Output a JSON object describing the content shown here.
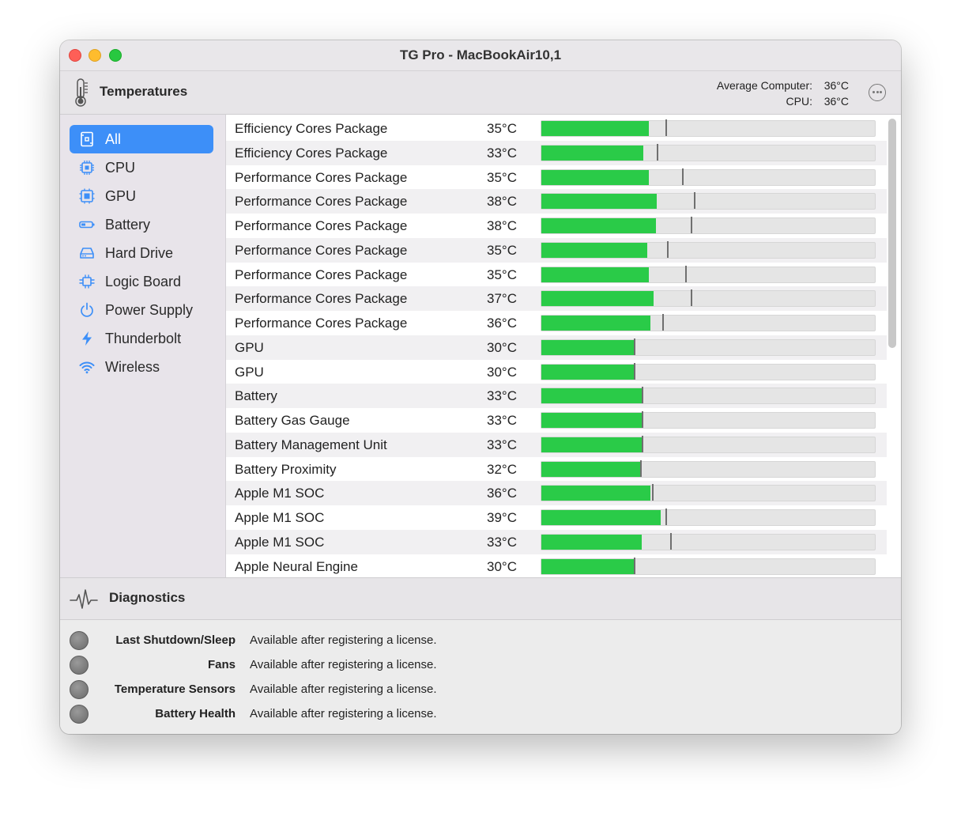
{
  "window": {
    "title": "TG Pro - MacBookAir10,1"
  },
  "temperatures": {
    "title": "Temperatures",
    "average_label": "Average Computer:",
    "average_value": "36°C",
    "cpu_label": "CPU:",
    "cpu_value": "36°C"
  },
  "sidebar": {
    "items": [
      {
        "label": "All",
        "icon": "board-icon",
        "active": true
      },
      {
        "label": "CPU",
        "icon": "chip-icon",
        "active": false
      },
      {
        "label": "GPU",
        "icon": "gpu-icon",
        "active": false
      },
      {
        "label": "Battery",
        "icon": "battery-icon",
        "active": false
      },
      {
        "label": "Hard Drive",
        "icon": "drive-icon",
        "active": false
      },
      {
        "label": "Logic Board",
        "icon": "logic-board-icon",
        "active": false
      },
      {
        "label": "Power Supply",
        "icon": "power-icon",
        "active": false
      },
      {
        "label": "Thunderbolt",
        "icon": "bolt-icon",
        "active": false
      },
      {
        "label": "Wireless",
        "icon": "wifi-icon",
        "active": false
      }
    ]
  },
  "sensors": [
    {
      "name": "Efficiency Cores Package",
      "temp": "35°C",
      "fill": 0.32,
      "max": 0.37
    },
    {
      "name": "Efficiency Cores Package",
      "temp": "33°C",
      "fill": 0.305,
      "max": 0.345
    },
    {
      "name": "Performance Cores Package",
      "temp": "35°C",
      "fill": 0.32,
      "max": 0.42
    },
    {
      "name": "Performance Cores Package",
      "temp": "38°C",
      "fill": 0.345,
      "max": 0.455
    },
    {
      "name": "Performance Cores Package",
      "temp": "38°C",
      "fill": 0.343,
      "max": 0.445
    },
    {
      "name": "Performance Cores Package",
      "temp": "35°C",
      "fill": 0.317,
      "max": 0.375
    },
    {
      "name": "Performance Cores Package",
      "temp": "35°C",
      "fill": 0.32,
      "max": 0.43
    },
    {
      "name": "Performance Cores Package",
      "temp": "37°C",
      "fill": 0.335,
      "max": 0.445
    },
    {
      "name": "Performance Cores Package",
      "temp": "36°C",
      "fill": 0.325,
      "max": 0.36
    },
    {
      "name": "GPU",
      "temp": "30°C",
      "fill": 0.275,
      "max": 0.275
    },
    {
      "name": "GPU",
      "temp": "30°C",
      "fill": 0.275,
      "max": 0.275
    },
    {
      "name": "Battery",
      "temp": "33°C",
      "fill": 0.3,
      "max": 0.3
    },
    {
      "name": "Battery Gas Gauge",
      "temp": "33°C",
      "fill": 0.3,
      "max": 0.3
    },
    {
      "name": "Battery Management Unit",
      "temp": "33°C",
      "fill": 0.3,
      "max": 0.3
    },
    {
      "name": "Battery Proximity",
      "temp": "32°C",
      "fill": 0.295,
      "max": 0.295
    },
    {
      "name": "Apple M1 SOC",
      "temp": "36°C",
      "fill": 0.325,
      "max": 0.33
    },
    {
      "name": "Apple M1 SOC",
      "temp": "39°C",
      "fill": 0.357,
      "max": 0.37
    },
    {
      "name": "Apple M1 SOC",
      "temp": "33°C",
      "fill": 0.3,
      "max": 0.385
    },
    {
      "name": "Apple Neural Engine",
      "temp": "30°C",
      "fill": 0.275,
      "max": 0.275
    }
  ],
  "diagnostics": {
    "title": "Diagnostics",
    "items": [
      {
        "label": "Last Shutdown/Sleep",
        "value": "Available after registering a license."
      },
      {
        "label": "Fans",
        "value": "Available after registering a license."
      },
      {
        "label": "Temperature Sensors",
        "value": "Available after registering a license."
      },
      {
        "label": "Battery Health",
        "value": "Available after registering a license."
      }
    ]
  },
  "colors": {
    "accent": "#3d8ff8",
    "bar_fill": "#2acb48",
    "bar_track": "#e5e5e5",
    "icon_blue": "#3d8ff8"
  }
}
